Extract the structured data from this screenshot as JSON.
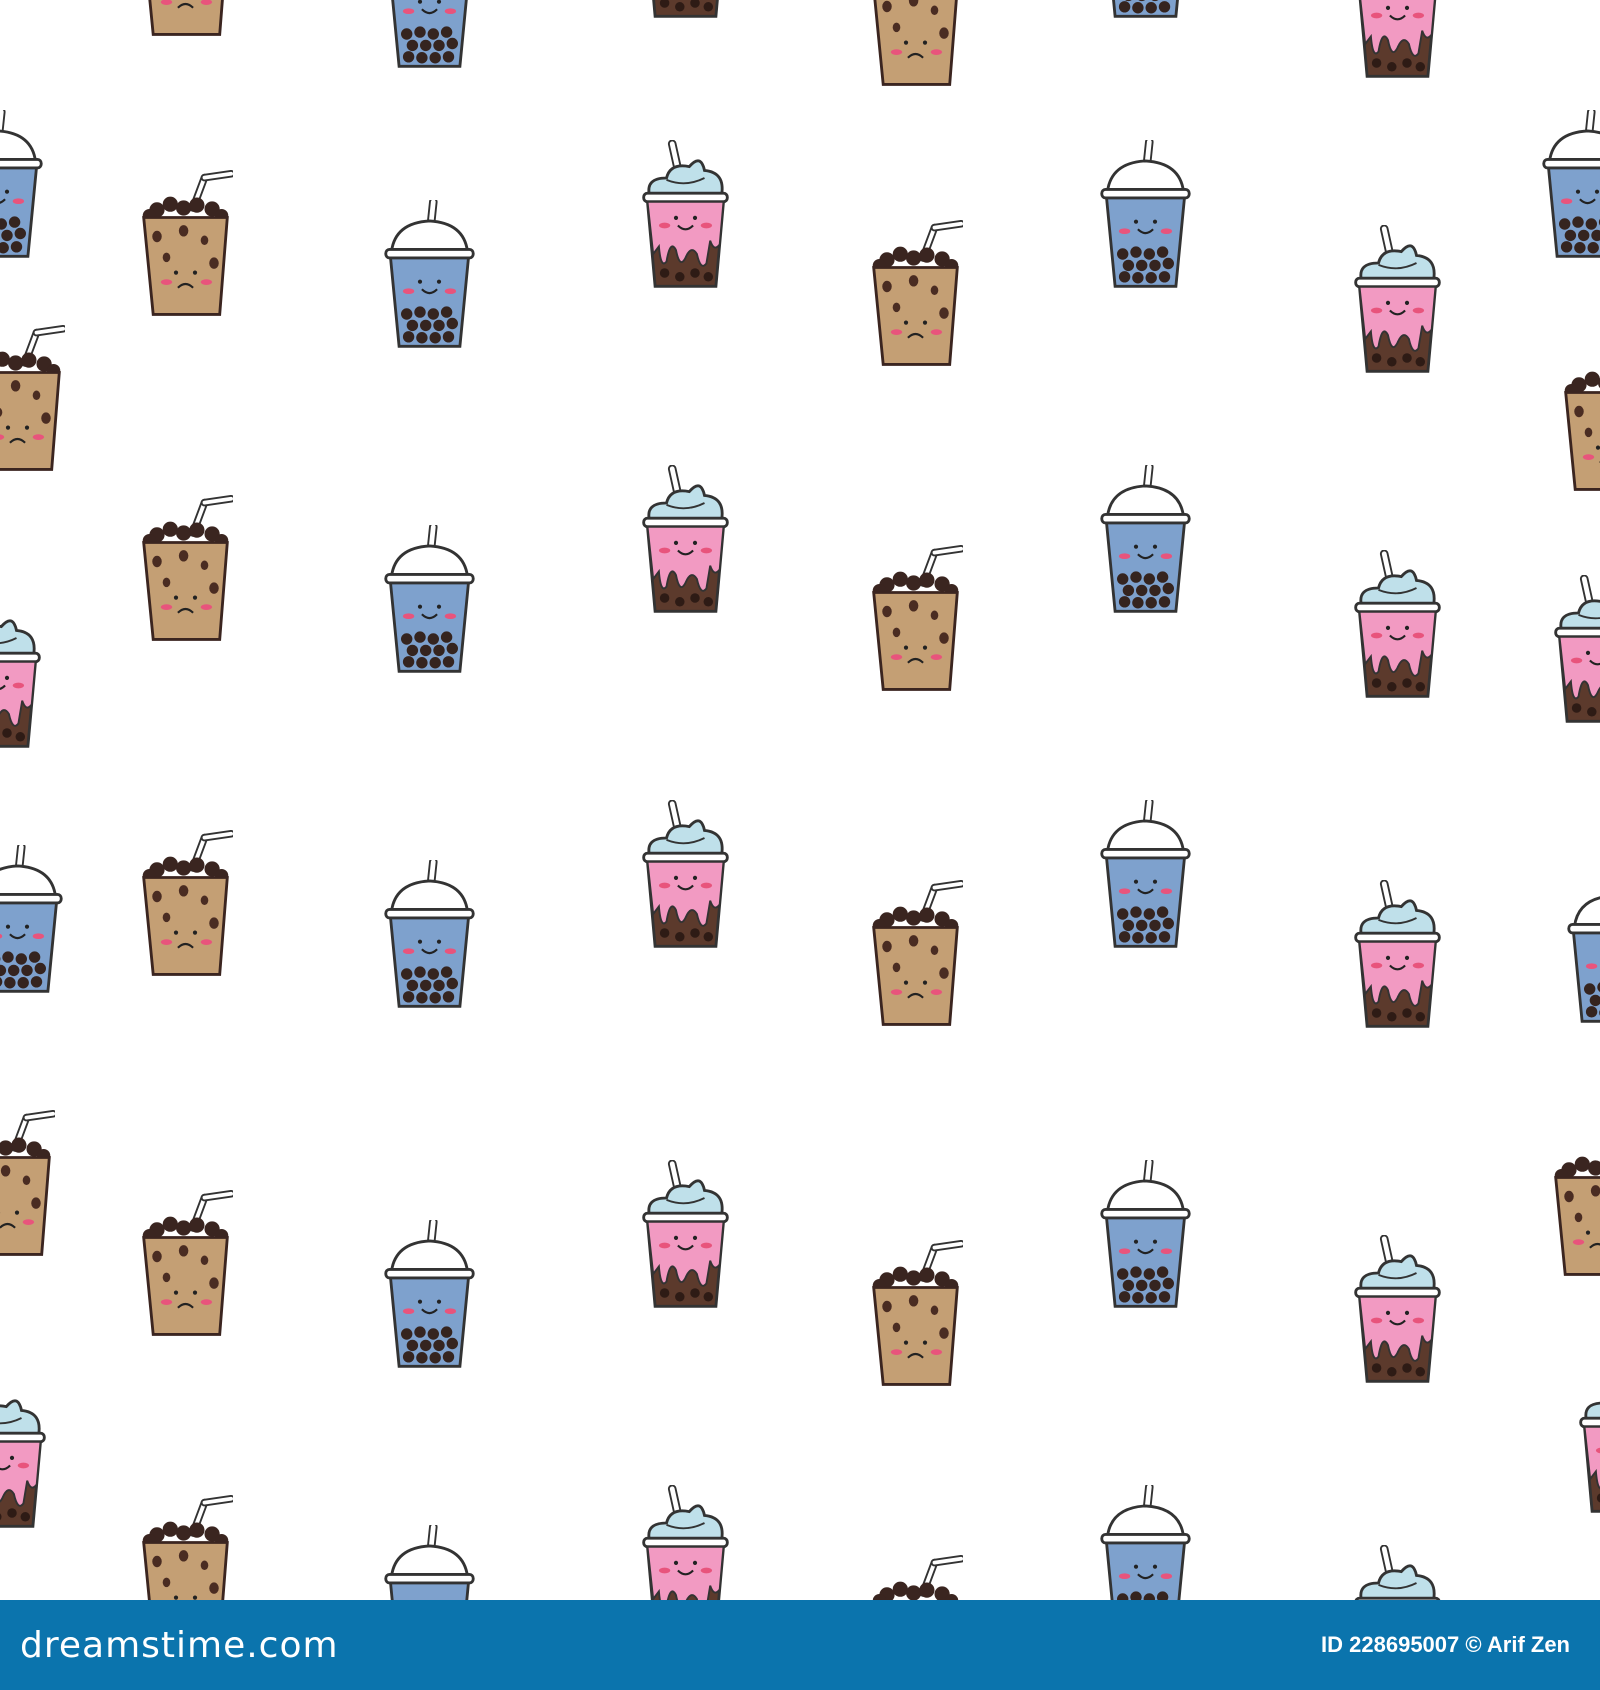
{
  "footer": {
    "brand": "dreamstime.com",
    "credit": "ID 228695007 © Arif Zen",
    "background": "#0b74ad"
  },
  "illustration": {
    "background": "#ffffff",
    "kinds": [
      "brown-boba-cup-icon",
      "blue-boba-cup-icon",
      "pink-frappe-cup-icon"
    ]
  }
}
